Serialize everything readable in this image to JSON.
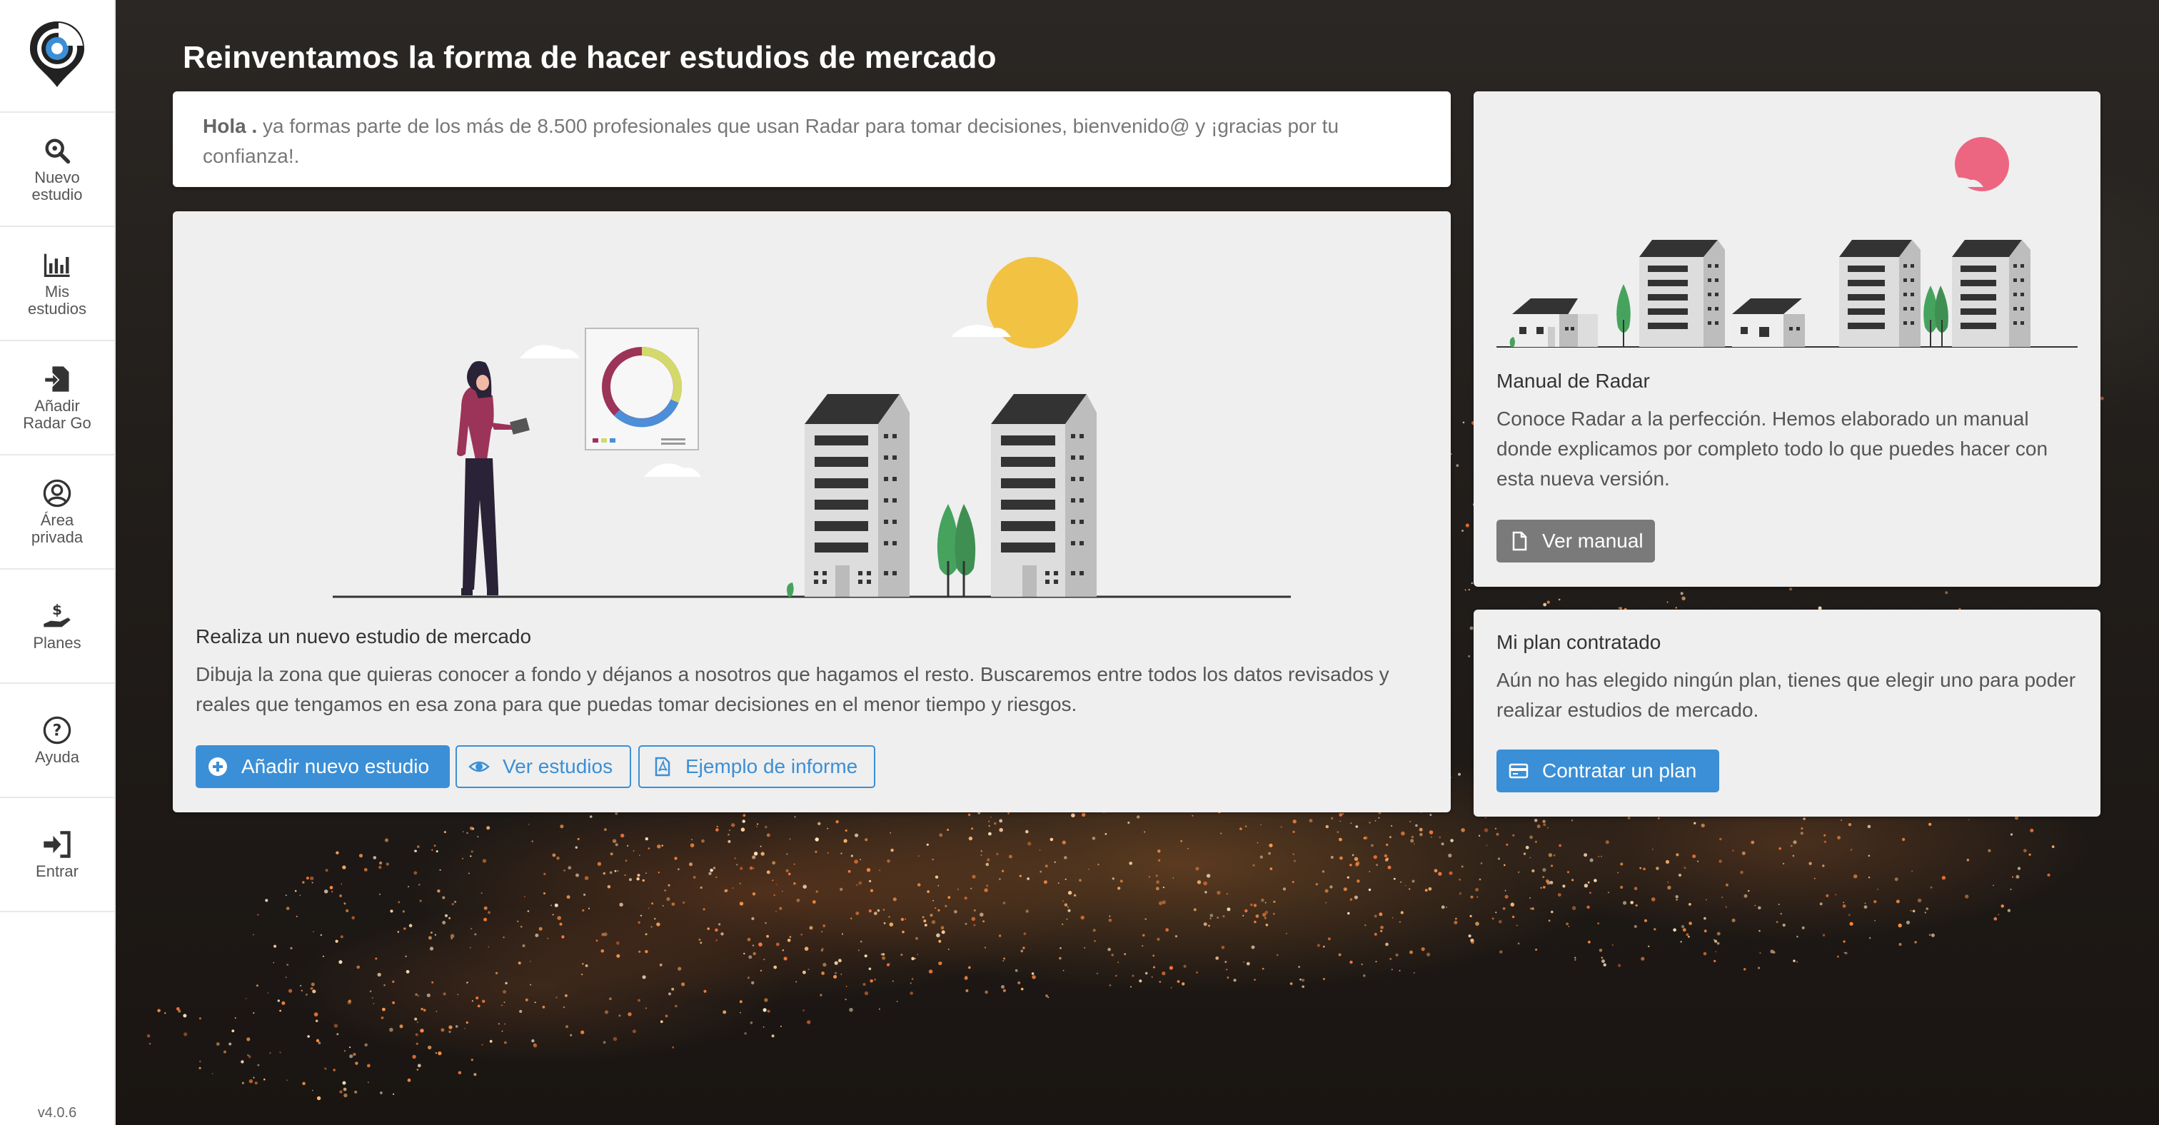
{
  "app": {
    "version": "v4.0.6"
  },
  "sidebar": {
    "items": [
      {
        "label": "Nuevo\nestudio",
        "icon": "search-icon"
      },
      {
        "label": "Mis\nestudios",
        "icon": "bar-chart-icon"
      },
      {
        "label": "Añadir\nRadar Go",
        "icon": "add-file-icon"
      },
      {
        "label": "Área\nprivada",
        "icon": "user-circle-icon"
      },
      {
        "label": "Planes",
        "icon": "hand-dollar-icon"
      },
      {
        "label": "Ayuda",
        "icon": "question-circle-icon"
      },
      {
        "label": "Entrar",
        "icon": "sign-in-icon"
      }
    ]
  },
  "header": {
    "title": "Reinventamos la forma de hacer estudios de mercado"
  },
  "welcome": {
    "greeting": "Hola .",
    "message": " ya formas parte de los más de 8.500 profesionales que usan Radar para tomar decisiones, bienvenido@ y ¡gracias por tu confianza!."
  },
  "main": {
    "title": "Realiza un nuevo estudio de mercado",
    "text": "Dibuja la zona que quieras conocer a fondo y déjanos a nosotros que hagamos el resto. Buscaremos entre todos los datos revisados y reales que tengamos en esa zona para que puedas tomar decisiones en el menor tiempo y riesgos.",
    "buttons": {
      "add": "Añadir nuevo estudio",
      "view": "Ver estudios",
      "example": "Ejemplo de informe"
    }
  },
  "manual": {
    "title": "Manual de Radar",
    "text": "Conoce Radar a la perfección. Hemos elaborado un manual donde explicamos por completo todo lo que puedes hacer con esta nueva versión.",
    "button": "Ver manual"
  },
  "plan": {
    "title": "Mi plan contratado",
    "text": "Aún no has elegido ningún plan, tienes que elegir uno para poder realizar estudios de mercado.",
    "button": "Contratar un plan"
  },
  "colors": {
    "primary": "#3b8fd6",
    "sun": "#f2c243",
    "pink_sun": "#ec6682",
    "tree": "#46a35e",
    "woman_top": "#9c3359"
  }
}
